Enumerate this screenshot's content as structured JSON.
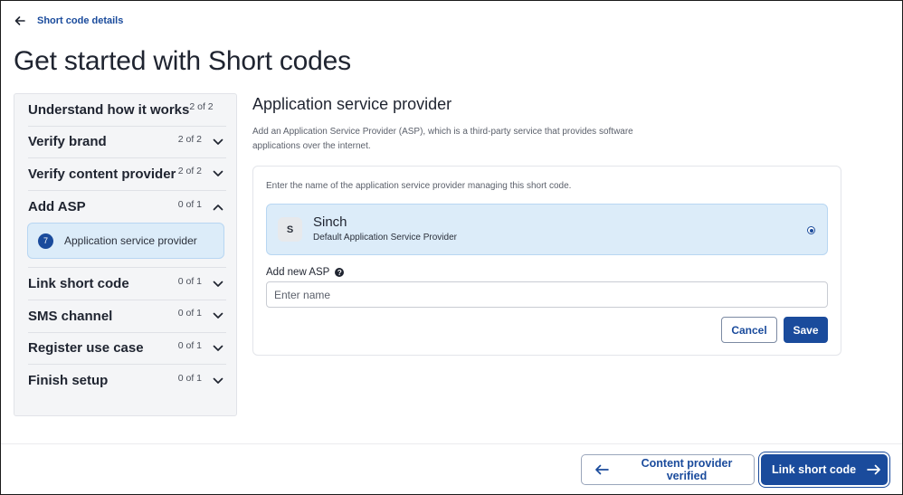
{
  "header": {
    "back_link_label": "Short code details",
    "page_title": "Get started with Short codes"
  },
  "sidebar": {
    "steps": [
      {
        "title": "Understand how it works",
        "count": "2 of 2",
        "icon": "chevron-down-icon"
      },
      {
        "title": "Verify brand",
        "count": "2 of 2",
        "icon": "chevron-down-icon"
      },
      {
        "title": "Verify content provider",
        "count": "2 of 2",
        "icon": "chevron-down-icon"
      },
      {
        "title": "Add ASP",
        "count": "0 of 1",
        "icon": "chevron-up-icon",
        "expanded": true,
        "substeps": [
          {
            "number": "7",
            "label": "Application service provider",
            "active": true
          }
        ]
      },
      {
        "title": "Link short code",
        "count": "0 of 1",
        "icon": "chevron-down-icon"
      },
      {
        "title": "SMS channel",
        "count": "0 of 1",
        "icon": "chevron-down-icon"
      },
      {
        "title": "Register use case",
        "count": "0 of 1",
        "icon": "chevron-down-icon"
      },
      {
        "title": "Finish setup",
        "count": "0 of 1",
        "icon": "chevron-down-icon"
      }
    ]
  },
  "main": {
    "title": "Application service provider",
    "description": "Add an Application Service Provider (ASP), which is a third-party service that provides software applications over the internet.",
    "card": {
      "hint": "Enter the name of the application service provider managing this short code.",
      "option": {
        "avatar": "S",
        "name": "Sinch",
        "subtitle": "Default Application Service Provider",
        "selected": true
      },
      "add_label": "Add new ASP",
      "help_icon": "?",
      "input_placeholder": "Enter name",
      "input_value": "",
      "cancel_label": "Cancel",
      "save_label": "Save"
    }
  },
  "footer": {
    "prev_label": "Content provider verified",
    "next_label": "Link short code"
  },
  "colors": {
    "primary": "#1a4b9c",
    "selected_bg": "#dcecf9",
    "sidebar_bg": "#f4f5f7"
  }
}
